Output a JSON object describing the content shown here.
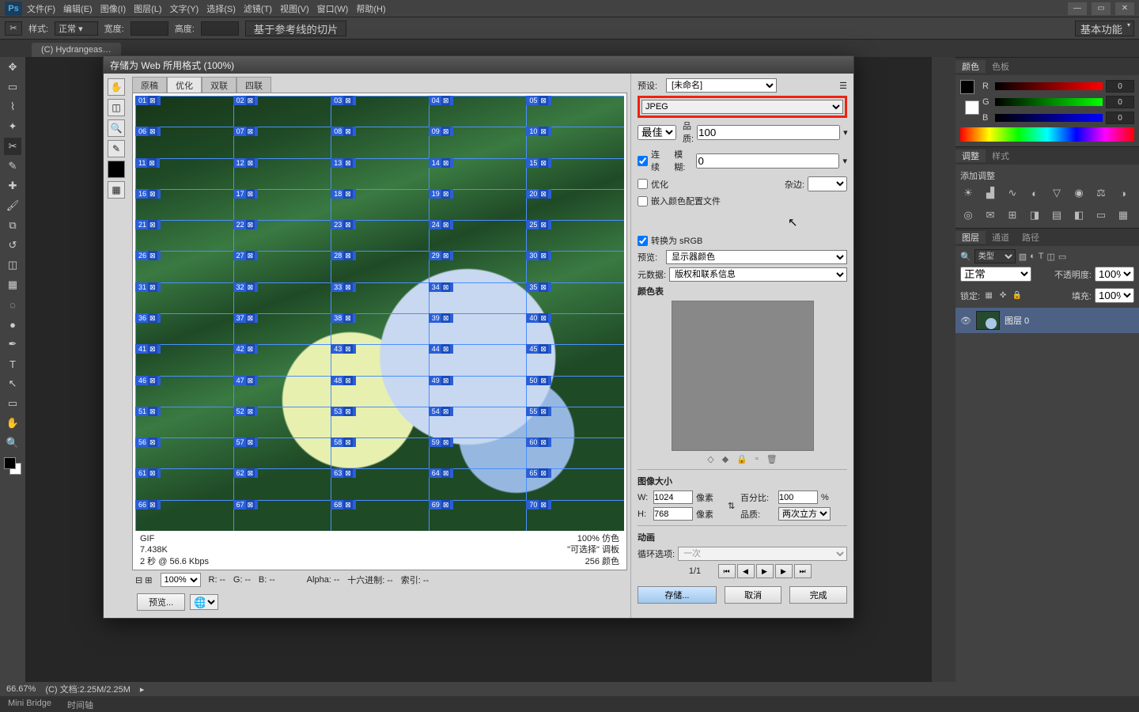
{
  "menu": {
    "items": [
      "文件(F)",
      "编辑(E)",
      "图像(I)",
      "图层(L)",
      "文字(Y)",
      "选择(S)",
      "滤镜(T)",
      "视图(V)",
      "窗口(W)",
      "帮助(H)"
    ]
  },
  "options_bar": {
    "style_label": "样式:",
    "style_value": "正常",
    "width_label": "宽度:",
    "height_label": "高度:",
    "slice_guides_btn": "基于参考线的切片",
    "workspace": "基本功能"
  },
  "doc_tab": "(C) Hydrangeas…",
  "dialog": {
    "title": "存储为 Web 所用格式 (100%)",
    "tabs": [
      "原稿",
      "优化",
      "双联",
      "四联"
    ],
    "preview_info": {
      "format": "GIF",
      "size": "7.438K",
      "time": "2 秒 @ 56.6 Kbps",
      "dither": "100% 仿色",
      "palette": "\"可选择\" 调板",
      "colors": "256 颜色"
    },
    "zoom_bar": {
      "zoom": "100%",
      "r": "R: --",
      "g": "G: --",
      "b": "B: --",
      "alpha": "Alpha: --",
      "hex": "十六进制: --",
      "index": "索引: --"
    },
    "footer": {
      "preview_btn": "预览..."
    },
    "right": {
      "preset_label": "预设:",
      "preset_value": "[未命名]",
      "format_value": "JPEG",
      "quality_grade": "最佳",
      "quality_label": "品质:",
      "quality_value": "100",
      "progressive_label": "连续",
      "blur_label": "模糊:",
      "blur_value": "0",
      "optimized_label": "优化",
      "matte_label": "杂边:",
      "embed_profile_label": "嵌入颜色配置文件",
      "convert_srgb_label": "转换为 sRGB",
      "preview_label": "预览:",
      "preview_value": "显示器颜色",
      "metadata_label": "元数据:",
      "metadata_value": "版权和联系信息",
      "color_table_label": "颜色表",
      "image_size_label": "图像大小",
      "w": "1024",
      "h": "768",
      "pixels": "像素",
      "percent_label": "百分比:",
      "percent_value": "100",
      "quality_method_label": "品质:",
      "quality_method_value": "两次立方",
      "animation_label": "动画",
      "loop_label": "循环选项:",
      "loop_value": "一次",
      "frame": "1/1",
      "save_btn": "存储...",
      "cancel_btn": "取消",
      "done_btn": "完成"
    }
  },
  "color_panel": {
    "tabs": [
      "颜色",
      "色板"
    ],
    "r": "0",
    "g": "0",
    "b": "0"
  },
  "adjust_panel": {
    "tabs": [
      "调整",
      "样式"
    ],
    "label": "添加调整"
  },
  "layers_panel": {
    "tabs": [
      "图层",
      "通道",
      "路径"
    ],
    "kind": "类型",
    "mode": "正常",
    "opacity_label": "不透明度:",
    "opacity_value": "100%",
    "lock_label": "锁定:",
    "fill_label": "填充:",
    "fill_value": "100%",
    "layer_name": "图层 0"
  },
  "status": {
    "zoom": "66.67%",
    "doc": "(C) 文档:2.25M/2.25M"
  },
  "bottom_tabs": [
    "Mini Bridge",
    "时间轴"
  ]
}
